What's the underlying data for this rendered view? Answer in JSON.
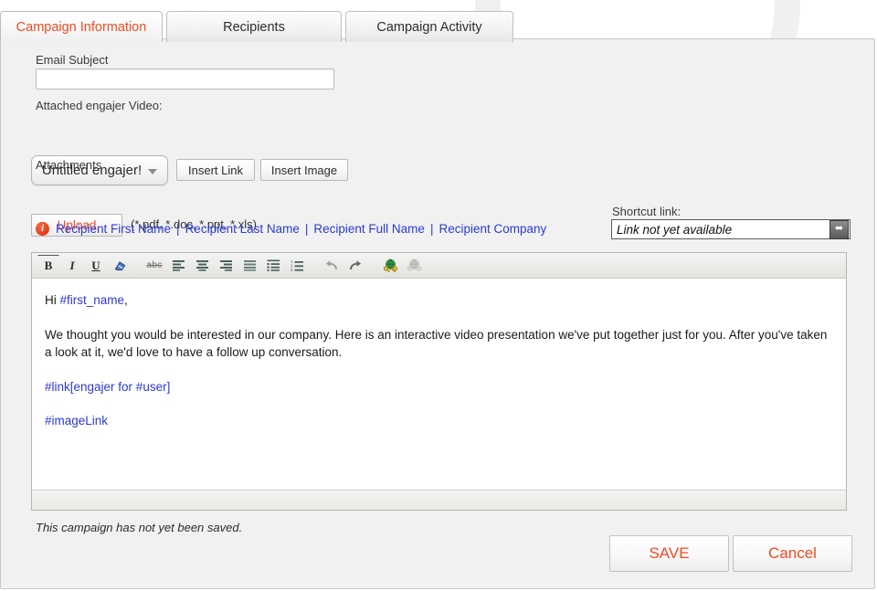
{
  "tabs": [
    {
      "label": "Campaign Information",
      "active": true
    },
    {
      "label": "Recipients",
      "active": false
    },
    {
      "label": "Campaign Activity",
      "active": false
    }
  ],
  "form": {
    "email_subject_label": "Email Subject",
    "email_subject_value": "",
    "email_subject_placeholder": "",
    "attached_video_label": "Attached engajer Video:",
    "engajer_select_value": "Untitled engajer!",
    "insert_link_label": "Insert Link",
    "insert_image_label": "Insert Image",
    "attachments_label": "Attachments",
    "upload_label": "Upload",
    "attachment_types": "(*.pdf, *.doc, *.ppt, *.xls)"
  },
  "merge_fields": {
    "info_icon": "info-icon",
    "info_glyph": "i",
    "separator": "|",
    "links": [
      "Recipient First Name",
      "Recipient Last Name",
      "Recipient Full Name",
      "Recipient Company"
    ]
  },
  "shortcut": {
    "label": "Shortcut link:",
    "value": "Link not yet available",
    "placeholder": "Link not yet available",
    "expand_icon": "expand-arrows-icon",
    "expand_glyph": "⬌"
  },
  "toolbar": {
    "items": [
      {
        "name": "bold-icon",
        "glyph": "B"
      },
      {
        "name": "italic-icon",
        "glyph": "I"
      },
      {
        "name": "underline-icon",
        "glyph": "U"
      },
      {
        "name": "remove-format-icon",
        "glyph": ""
      },
      {
        "name": "strikethrough-icon",
        "glyph": "abc"
      },
      {
        "name": "align-left-icon",
        "glyph": ""
      },
      {
        "name": "align-center-icon",
        "glyph": ""
      },
      {
        "name": "align-right-icon",
        "glyph": ""
      },
      {
        "name": "align-justify-icon",
        "glyph": ""
      },
      {
        "name": "bulleted-list-icon",
        "glyph": ""
      },
      {
        "name": "numbered-list-icon",
        "glyph": ""
      },
      {
        "name": "undo-icon",
        "glyph": ""
      },
      {
        "name": "redo-icon",
        "glyph": ""
      },
      {
        "name": "insert-link-icon",
        "glyph": ""
      },
      {
        "name": "unlink-icon",
        "glyph": ""
      }
    ]
  },
  "editor": {
    "greeting_prefix": "Hi ",
    "greeting_merge": "#first_name",
    "greeting_suffix": ",",
    "paragraph": "We thought you would be interested in our company. Here is an interactive video presentation we've put together just for you. After you've taken a look at it, we'd love to have a follow up conversation.",
    "link_placeholder": "#link[engajer for #user]",
    "image_link_placeholder": "#imageLink"
  },
  "footer": {
    "status": "This campaign has not yet been saved.",
    "save_label": "SAVE",
    "cancel_label": "Cancel"
  },
  "colors": {
    "accent": "#f04b23",
    "link": "#2a3ad6",
    "panel_bg": "#f1f1f1",
    "border": "#c8c8c8"
  }
}
